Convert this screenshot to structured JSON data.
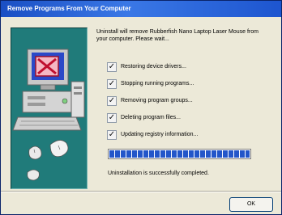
{
  "window": {
    "title": "Remove Programs From Your Computer"
  },
  "intro_text": "Uninstall will remove Rubberfish Nano Laptop Laser Mouse from your computer. Please wait...",
  "steps": [
    {
      "label": "Restoring device drivers...",
      "checked": true
    },
    {
      "label": "Stopping running programs...",
      "checked": true
    },
    {
      "label": "Removing program groups...",
      "checked": true
    },
    {
      "label": "Deleting program files...",
      "checked": true
    },
    {
      "label": "Updating registry information...",
      "checked": true
    }
  ],
  "check_mark": "✓",
  "progress": {
    "percent": 100
  },
  "status_text": "Uninstallation is successfully completed.",
  "buttons": {
    "ok": "OK"
  },
  "colors": {
    "title_bar": "#1a4fc4",
    "art_background": "#207b7a",
    "progress_fill": "#2356c9",
    "window_face": "#ece9d8"
  },
  "icons": [
    "computer-icon",
    "delete-cross-icon",
    "mouse-icon"
  ]
}
